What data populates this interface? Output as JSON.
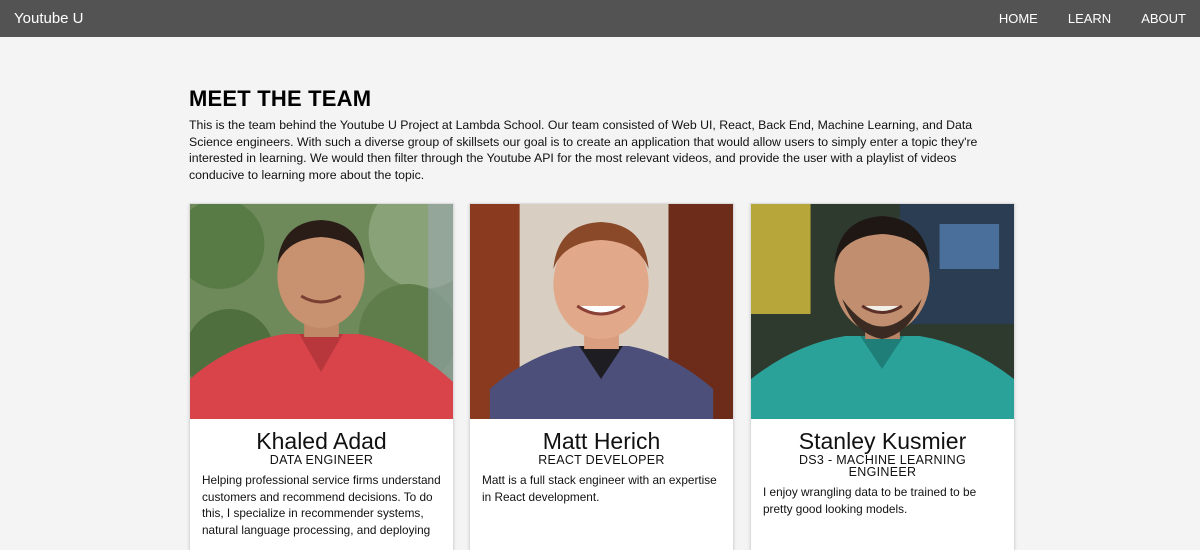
{
  "nav": {
    "brand": "Youtube U",
    "links": [
      "HOME",
      "LEARN",
      "ABOUT"
    ]
  },
  "page": {
    "title": "MEET THE TEAM",
    "intro": "This is the team behind the Youtube U Project at Lambda School. Our team consisted of Web UI, React, Back End, Machine Learning, and Data Science engineers. With such a diverse group of skillsets our goal is to create an application that would allow users to simply enter a topic they're interested in learning. We would then filter through the Youtube API for the most relevant videos, and provide the user with a playlist of videos conducive to learning more about the topic."
  },
  "team": [
    {
      "name": "Khaled Adad",
      "role": "DATA ENGINEER",
      "bio": "Helping professional service firms understand customers and recommend decisions. To do this, I specialize in recommender systems, natural language processing, and deploying"
    },
    {
      "name": "Matt Herich",
      "role": "REACT DEVELOPER",
      "bio": "Matt is a full stack engineer with an expertise in React development."
    },
    {
      "name": "Stanley Kusmier",
      "role": "DS3 - MACHINE LEARNING ENGINEER",
      "bio": "I enjoy wrangling data to be trained to be pretty good looking models."
    }
  ],
  "colors": {
    "navbar": "#535353",
    "background": "#f4f4f4",
    "card": "#ffffff"
  }
}
